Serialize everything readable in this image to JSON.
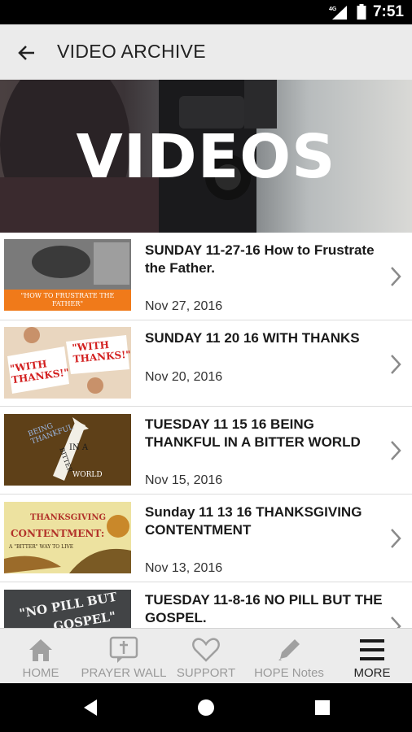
{
  "status_bar": {
    "network": "4G",
    "time": "7:51"
  },
  "app_bar": {
    "title": "VIDEO ARCHIVE"
  },
  "banner": {
    "title": "VIDEOS"
  },
  "videos": [
    {
      "title": "SUNDAY 11-27-16  How to Frustrate the Father.",
      "date": "Nov 27, 2016",
      "thumb_text": "\"HOW TO FRUSTRATE THE FATHER\""
    },
    {
      "title": "SUNDAY 11 20 16 WITH THANKS",
      "date": "Nov 20, 2016",
      "thumb_text_1": "\"WITH THANKS!\"",
      "thumb_text_2": "\"WITH THANKS!\""
    },
    {
      "title": "TUESDAY 11 15 16 BEING THANKFUL IN A BITTER WORLD",
      "date": "Nov 15, 2016",
      "thumb_text_1": "BEING THANKFUL",
      "thumb_text_2": "IN A",
      "thumb_text_3": "BITTER",
      "thumb_text_4": "WORLD"
    },
    {
      "title": "Sunday 11 13 16 THANKSGIVING CONTENTMENT",
      "date": "Nov 13, 2016",
      "thumb_text_1": "THANKSGIVING",
      "thumb_text_2": "CONTENTMENT:",
      "thumb_text_3": "A \"BITTER\" WAY TO LIVE"
    },
    {
      "title": "TUESDAY 11-8-16 NO PILL BUT THE GOSPEL.",
      "date": "",
      "thumb_text_1": "\"NO PILL BUT",
      "thumb_text_2": "GOSPEL\""
    }
  ],
  "bottom_nav": [
    {
      "label": "HOME",
      "icon": "home-icon"
    },
    {
      "label": "PRAYER WALL",
      "icon": "prayer-wall-icon"
    },
    {
      "label": "SUPPORT",
      "icon": "heart-icon"
    },
    {
      "label": "HOPE Notes",
      "icon": "pencil-icon"
    },
    {
      "label": "MORE",
      "icon": "menu-icon"
    }
  ]
}
